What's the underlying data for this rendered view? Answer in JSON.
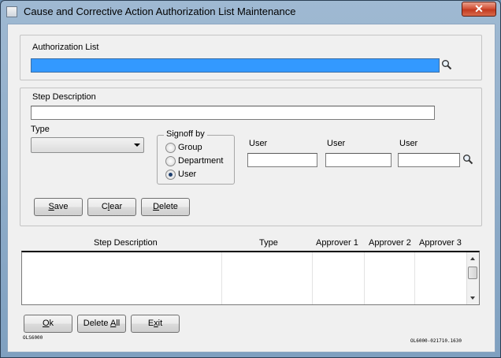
{
  "window": {
    "title": "Cause and Corrective Action Authorization List Maintenance",
    "close_label": "✕"
  },
  "auth": {
    "label": "Authorization List",
    "value": ""
  },
  "step": {
    "label": "Step Description",
    "value": ""
  },
  "type": {
    "label": "Type",
    "value": ""
  },
  "signoff": {
    "legend": "Signoff by",
    "options": [
      "Group",
      "Department",
      "User"
    ],
    "selected": "User"
  },
  "users": {
    "labels": [
      "User",
      "User",
      "User"
    ],
    "values": [
      "",
      "",
      ""
    ]
  },
  "buttons": {
    "save": {
      "pre": "",
      "mn": "S",
      "post": "ave"
    },
    "clear": {
      "pre": "C",
      "mn": "l",
      "post": "ear"
    },
    "delete": {
      "pre": "",
      "mn": "D",
      "post": "elete"
    },
    "ok": {
      "pre": "",
      "mn": "O",
      "post": "k"
    },
    "delete_all": {
      "pre": "Delete ",
      "mn": "A",
      "post": "ll"
    },
    "exit": {
      "pre": "E",
      "mn": "x",
      "post": "it"
    }
  },
  "table": {
    "columns": [
      "Step Description",
      "Type",
      "Approver 1",
      "Approver 2",
      "Approver 3"
    ],
    "rows": []
  },
  "footer": {
    "form_code": "OLS6000",
    "version": "OL6000-021710.1630"
  }
}
